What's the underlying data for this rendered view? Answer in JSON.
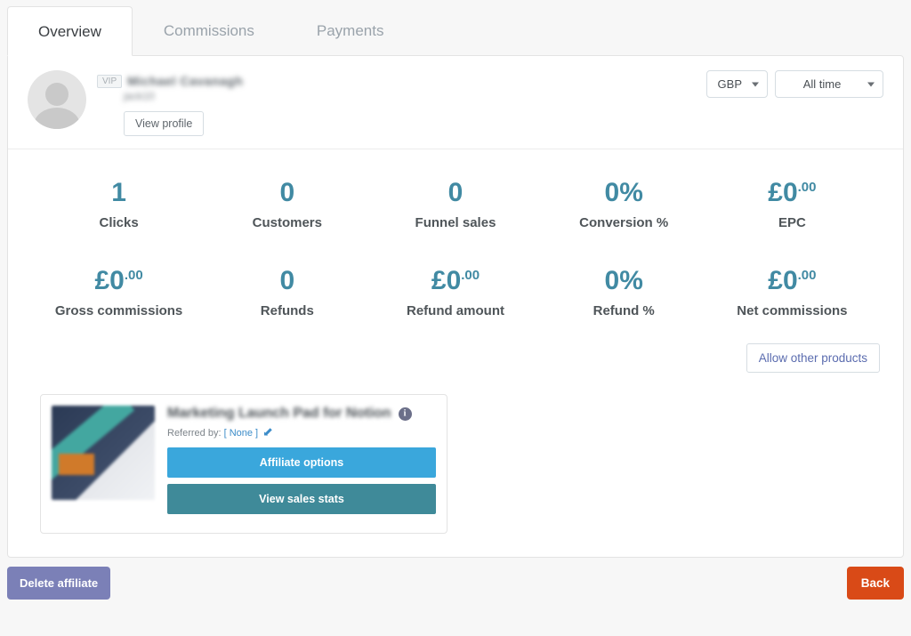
{
  "tabs": {
    "overview": "Overview",
    "commissions": "Commissions",
    "payments": "Payments"
  },
  "profile": {
    "vip_badge": "VIP",
    "name": "Michael Cavanagh",
    "handle": "jack10",
    "view_profile_label": "View profile"
  },
  "filters": {
    "currency": "GBP",
    "period": "All time"
  },
  "currency_symbol": "£",
  "stats": [
    {
      "value_int": "1",
      "value_dec": "",
      "suffix": "",
      "prefix": "",
      "label": "Clicks"
    },
    {
      "value_int": "0",
      "value_dec": "",
      "suffix": "",
      "prefix": "",
      "label": "Customers"
    },
    {
      "value_int": "0",
      "value_dec": "",
      "suffix": "",
      "prefix": "",
      "label": "Funnel sales"
    },
    {
      "value_int": "0",
      "value_dec": "",
      "suffix": "%",
      "prefix": "",
      "label": "Conversion %"
    },
    {
      "value_int": "0",
      "value_dec": ".00",
      "suffix": "",
      "prefix": "£",
      "label": "EPC"
    },
    {
      "value_int": "0",
      "value_dec": ".00",
      "suffix": "",
      "prefix": "£",
      "label": "Gross commissions"
    },
    {
      "value_int": "0",
      "value_dec": "",
      "suffix": "",
      "prefix": "",
      "label": "Refunds"
    },
    {
      "value_int": "0",
      "value_dec": ".00",
      "suffix": "",
      "prefix": "£",
      "label": "Refund amount"
    },
    {
      "value_int": "0",
      "value_dec": "",
      "suffix": "%",
      "prefix": "",
      "label": "Refund %"
    },
    {
      "value_int": "0",
      "value_dec": ".00",
      "suffix": "",
      "prefix": "£",
      "label": "Net commissions"
    }
  ],
  "allow_other_products_label": "Allow other products",
  "product": {
    "title": "Marketing Launch Pad for Notion",
    "referred_by_label": "Referred by:",
    "referred_by_value": "[ None ]",
    "affiliate_options_label": "Affiliate options",
    "view_sales_stats_label": "View sales stats"
  },
  "footer": {
    "delete_label": "Delete affiliate",
    "back_label": "Back"
  }
}
